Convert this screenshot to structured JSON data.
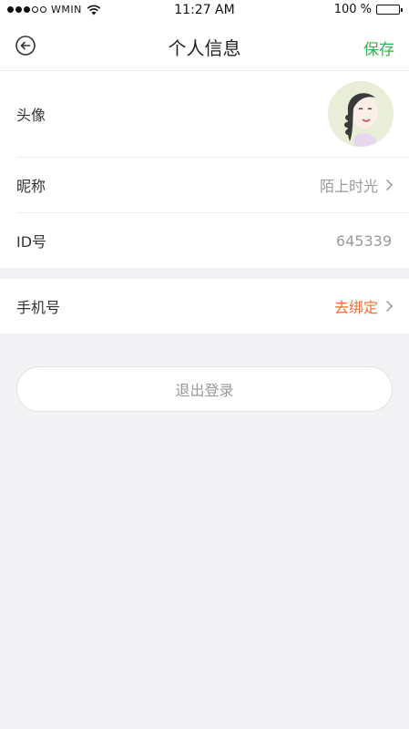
{
  "status_bar": {
    "carrier": "WMIN",
    "time": "11:27 AM",
    "battery": "100 %"
  },
  "header": {
    "title": "个人信息",
    "save_label": "保存",
    "back_icon": "back-arrow-circle-icon"
  },
  "profile": {
    "avatar_label": "头像",
    "nickname_label": "昵称",
    "nickname_value": "陌上时光",
    "id_label": "ID号",
    "id_value": "645339"
  },
  "contact": {
    "phone_label": "手机号",
    "phone_action": "去绑定"
  },
  "logout_label": "退出登录",
  "colors": {
    "accent_green": "#35b24b",
    "link_orange": "#f0712d",
    "background": "#f3f2f5"
  }
}
